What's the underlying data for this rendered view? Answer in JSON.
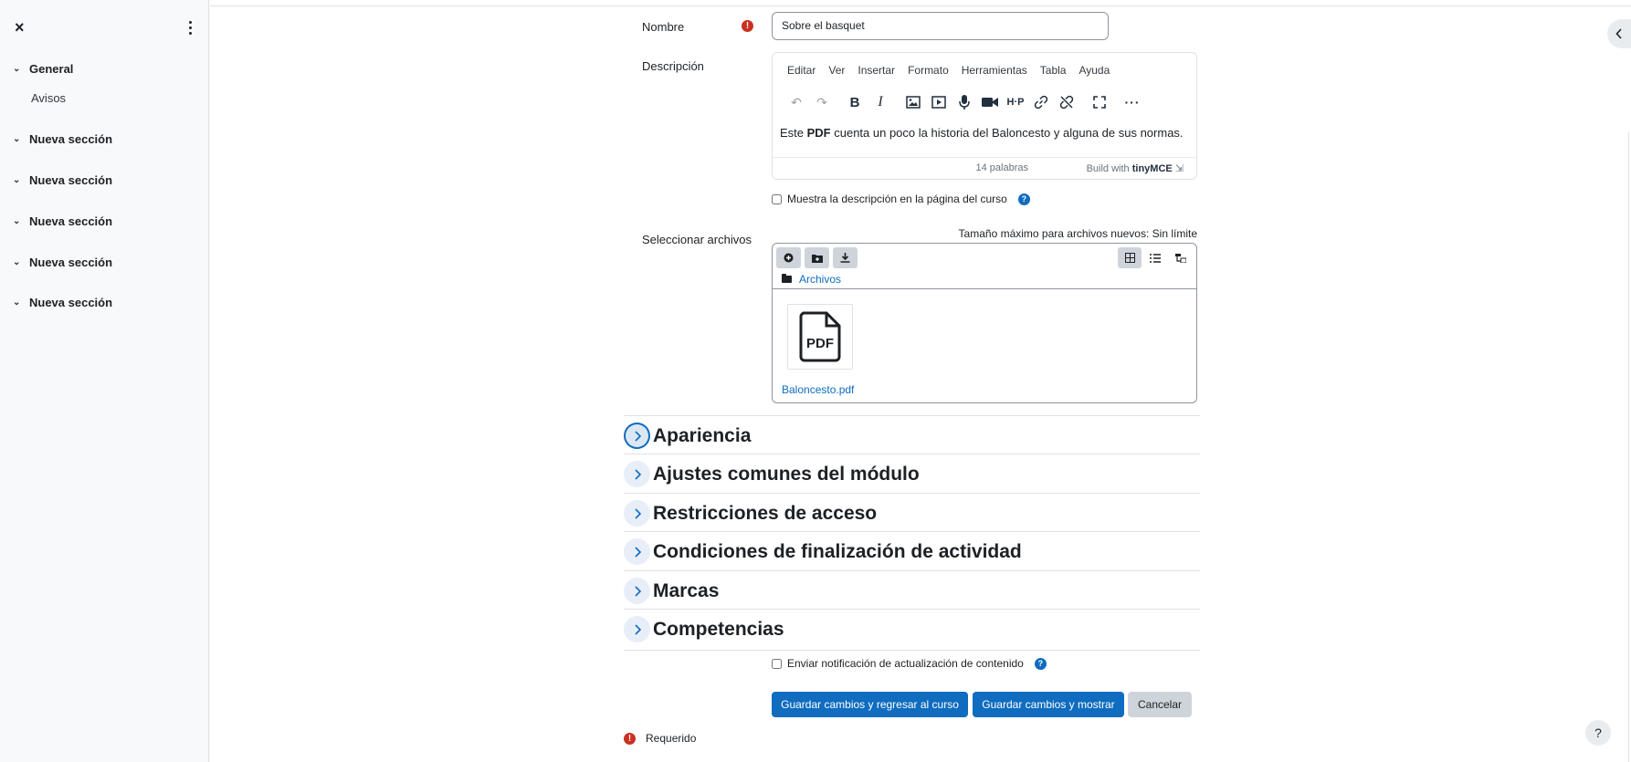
{
  "sidebar": {
    "close_icon": "×",
    "sections": [
      {
        "label": "General"
      },
      {
        "label": "Nueva sección"
      },
      {
        "label": "Nueva sección"
      },
      {
        "label": "Nueva sección"
      },
      {
        "label": "Nueva sección"
      },
      {
        "label": "Nueva sección"
      }
    ],
    "sub_item": "Avisos"
  },
  "form": {
    "name_label": "Nombre",
    "name_value": "Sobre el basquet",
    "description_label": "Descripción",
    "editor": {
      "menu": [
        "Editar",
        "Ver",
        "Insertar",
        "Formato",
        "Herramientas",
        "Tabla",
        "Ayuda"
      ],
      "content_prefix": "Este ",
      "content_bold": "PDF",
      "content_suffix": " cuenta un poco la historia del Baloncesto y alguna de sus normas.",
      "word_count": "14 palabras",
      "built_with": "Build with",
      "brand": "tinyMCE"
    },
    "show_description_label": "Muestra la descripción en la página del curso",
    "files_label": "Seleccionar archivos",
    "max_size": "Tamaño máximo para archivos nuevos: Sin límite",
    "filepicker": {
      "path": "Archivos",
      "file_name": "Baloncesto.pdf",
      "file_icon_text": "PDF"
    },
    "sections": [
      {
        "title": "Apariencia"
      },
      {
        "title": "Ajustes comunes del módulo"
      },
      {
        "title": "Restricciones de acceso"
      },
      {
        "title": "Condiciones de finalización de actividad"
      },
      {
        "title": "Marcas"
      },
      {
        "title": "Competencias"
      }
    ],
    "notify_label": "Enviar notificación de actualización de contenido",
    "buttons": {
      "save_return": "Guardar cambios y regresar al curso",
      "save_show": "Guardar cambios y mostrar",
      "cancel": "Cancelar"
    },
    "required_label": "Requerido"
  },
  "help_fab": "?",
  "colors": {
    "primary": "#0f6cbf",
    "required": "#ca3120"
  }
}
